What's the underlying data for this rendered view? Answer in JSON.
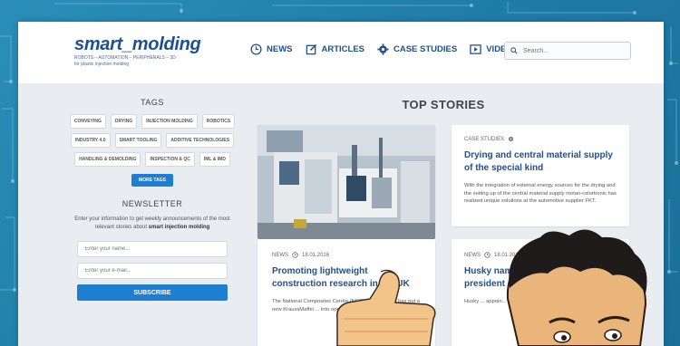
{
  "header": {
    "logo": {
      "name": "smart_molding",
      "tagline_1": "ROBOTS – AUTOMATION – PERIPHERALS – 3D",
      "tagline_2": "for plastic injection molding"
    },
    "nav": [
      {
        "label": "NEWS",
        "icon": "clock-icon"
      },
      {
        "label": "ARTICLES",
        "icon": "edit-icon"
      },
      {
        "label": "CASE STUDIES",
        "icon": "gear-icon"
      },
      {
        "label": "VIDEOS",
        "icon": "play-icon"
      }
    ],
    "search_placeholder": "Search..."
  },
  "sidebar": {
    "tags_title": "TAGS",
    "tags": [
      "CONVEYING",
      "DRYING",
      "INJECTION MOLDING",
      "ROBOTICS",
      "INDUSTRY 4.0",
      "SMART TOOLING",
      "ADDITIVE TECHNOLOGIES",
      "HANDLING & DEMOLDING",
      "INSPECTION & QC",
      "IML & IMD"
    ],
    "more_tags_label": "MORE TAGS",
    "newsletter": {
      "title": "NEWSLETTER",
      "text_plain": "Enter your information to get weekly announcements of the most relevant stories about",
      "text_bold": "smart injection molding",
      "name_placeholder": "Enter your name...",
      "email_placeholder": "Enter your e-mail...",
      "subscribe_label": "SUBSCRIBE"
    }
  },
  "main": {
    "title": "TOP STORIES",
    "stories": [
      {
        "category": "CASE STUDIES",
        "title": "Drying and central material supply of the special kind",
        "text": "With the integration of external energy sources for the drying and the setting up of the central material supply motan-colortronic has realized unique solutions at the automotive supplier FKT."
      },
      {
        "category": "NEWS",
        "date": "18.01.2016",
        "title": "Promoting lightweight construction research in the UK",
        "text": "The National Composites Centre (NCC) ... Bristol, UK has put a new KraussMaffei ... into operation."
      },
      {
        "category": "NEWS",
        "date": "18.01.2016",
        "title": "Husky names ... president ... control",
        "text": "Husky ... appoin... Presid..."
      }
    ]
  },
  "colors": {
    "brand": "#1e4f8f",
    "accent_button": "#1e7fd1",
    "background": "#e9ecf1",
    "outer": "#2a8fb8"
  }
}
